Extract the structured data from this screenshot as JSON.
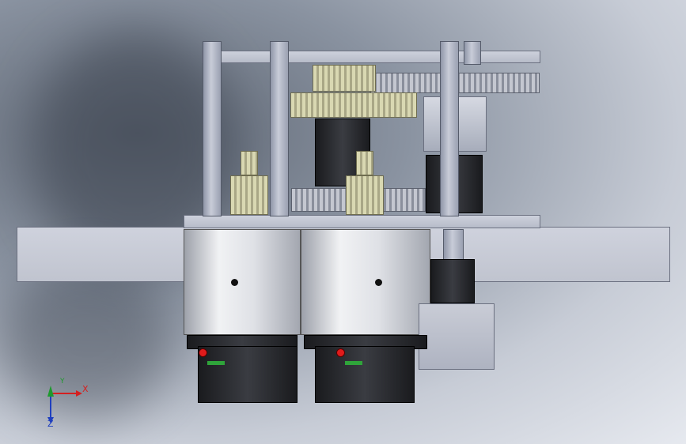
{
  "triad": {
    "x_label": "X",
    "y_label": "Y",
    "z_label": "Z",
    "x_color": "#d42020",
    "y_color": "#1e9a2e",
    "z_color": "#1f3fbf"
  },
  "colors": {
    "frame_plate": "#c3c7d2",
    "spur_gear_light": "#d9d8b2",
    "motor_body": "#e4e6ea",
    "motor_base": "#25272b",
    "indicator_red": "#e01b1b",
    "indicator_green": "#2fa43a"
  }
}
